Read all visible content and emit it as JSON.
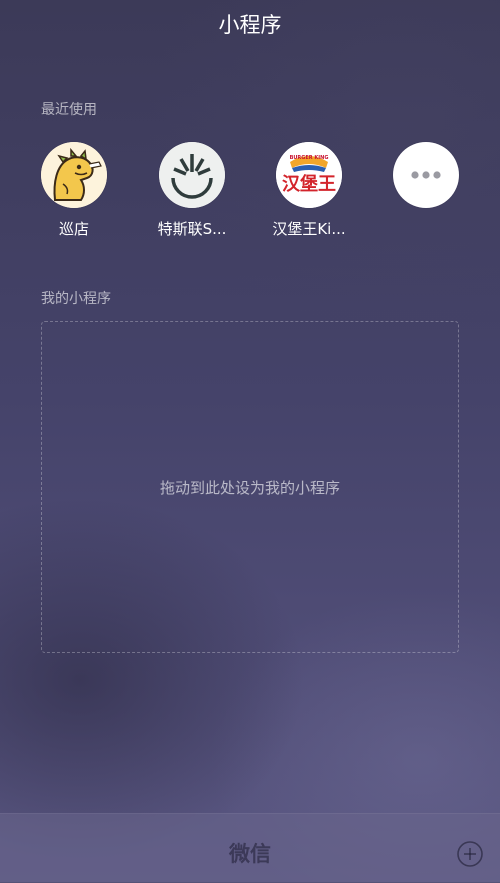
{
  "header": {
    "title": "小程序"
  },
  "recent": {
    "label": "最近使用",
    "apps": [
      {
        "name": "巡店",
        "icon": "dinosaur-icon"
      },
      {
        "name": "特斯联S...",
        "icon": "teslink-logo-icon"
      },
      {
        "name": "汉堡王Ki...",
        "icon": "burger-king-logo-icon",
        "logo_text": "汉堡王",
        "logo_small": "BURGER KING"
      },
      {
        "name": "",
        "icon": "more-icon"
      }
    ]
  },
  "mine": {
    "label": "我的小程序",
    "drop_hint": "拖动到此处设为我的小程序"
  },
  "bottom": {
    "title": "微信",
    "add_icon": "plus-circle-icon"
  }
}
